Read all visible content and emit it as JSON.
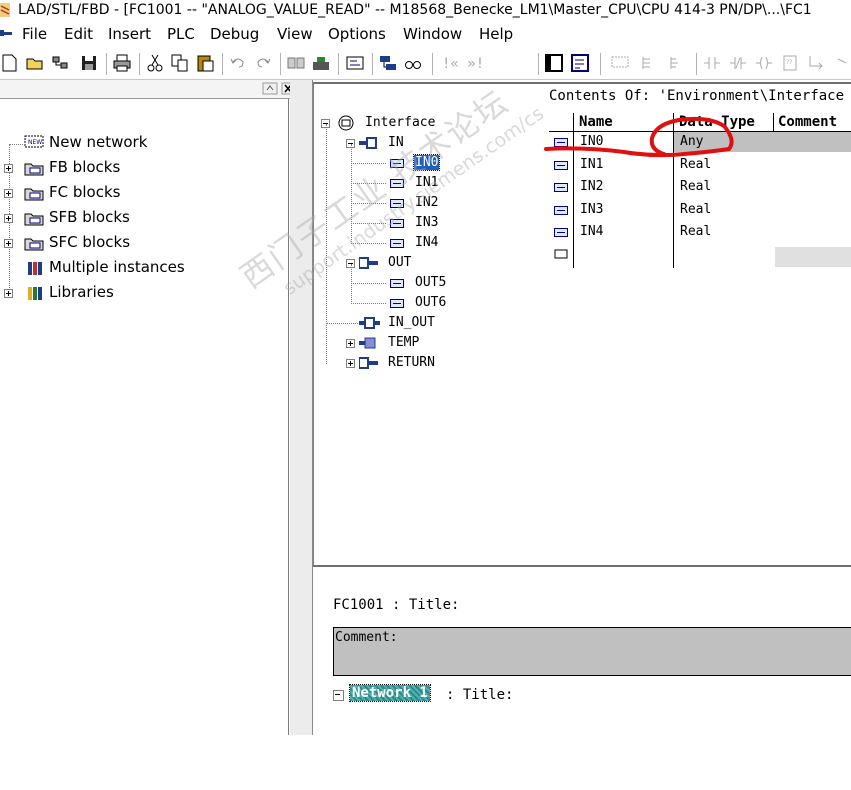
{
  "window": {
    "title": "LAD/STL/FBD  - [FC1001 -- \"ANALOG_VALUE_READ\" -- M18568_Benecke_LM1\\Master_CPU\\CPU 414-3 PN/DP\\...\\FC1"
  },
  "menu": {
    "items": [
      "File",
      "Edit",
      "Insert",
      "PLC",
      "Debug",
      "View",
      "Options",
      "Window",
      "Help"
    ]
  },
  "toolbar": {
    "buttons": [
      "new-icon",
      "open-icon",
      "accessible-nodes-icon",
      "save-icon",
      "print-icon",
      "cut-icon",
      "copy-icon",
      "paste-icon",
      "undo-icon",
      "redo-icon",
      "download-icon",
      "compare-icon",
      "overview-icon",
      "details-icon",
      "monitor-icon",
      "glasses-icon",
      "previous-icon",
      "next-icon",
      "program-elements-icon",
      "call-structure-icon",
      "network-icon",
      "branch-icon",
      "normally-open-icon",
      "normally-closed-icon",
      "coil-icon",
      "empty-box-icon",
      "open-branch-icon"
    ]
  },
  "left_tree": {
    "items": [
      {
        "label": "New network",
        "icon": "new-network-icon",
        "expandable": false
      },
      {
        "label": "FB blocks",
        "icon": "folder-block-icon",
        "expandable": true
      },
      {
        "label": "FC blocks",
        "icon": "folder-block-icon",
        "expandable": true
      },
      {
        "label": "SFB blocks",
        "icon": "folder-block-icon",
        "expandable": true
      },
      {
        "label": "SFC blocks",
        "icon": "folder-block-icon",
        "expandable": true
      },
      {
        "label": "Multiple instances",
        "icon": "multiple-instances-icon",
        "expandable": false
      },
      {
        "label": "Libraries",
        "icon": "libraries-icon",
        "expandable": true
      }
    ]
  },
  "interface_tree": {
    "root": "Interface",
    "in_label": "IN",
    "in_params": [
      "IN0",
      "IN1",
      "IN2",
      "IN3",
      "IN4"
    ],
    "selected": "IN0",
    "out_label": "OUT",
    "out_params": [
      "OUT5",
      "OUT6"
    ],
    "in_out_label": "IN_OUT",
    "temp_label": "TEMP",
    "return_label": "RETURN"
  },
  "contents": {
    "header": "Contents Of: 'Environment\\Interface",
    "columns": [
      "Name",
      "Data Type",
      "Comment"
    ],
    "rows": [
      {
        "name": "IN0",
        "type": "Any"
      },
      {
        "name": "IN1",
        "type": "Real"
      },
      {
        "name": "IN2",
        "type": "Real"
      },
      {
        "name": "IN3",
        "type": "Real"
      },
      {
        "name": "IN4",
        "type": "Real"
      }
    ]
  },
  "editor": {
    "block_title": "FC1001 : Title:",
    "comment_label": "Comment:",
    "network_label": "Network 1",
    "network_title": ": Title:"
  },
  "annotation": {
    "color": "#e01010"
  },
  "watermark": {
    "line1": "西门子工业 技术论坛",
    "line2": "support.industry.siemens.com/cs"
  },
  "colors": {
    "selection": "#1f5fbf",
    "comment_bg": "#c0c0c0",
    "network_label": "#2a8a8a"
  }
}
